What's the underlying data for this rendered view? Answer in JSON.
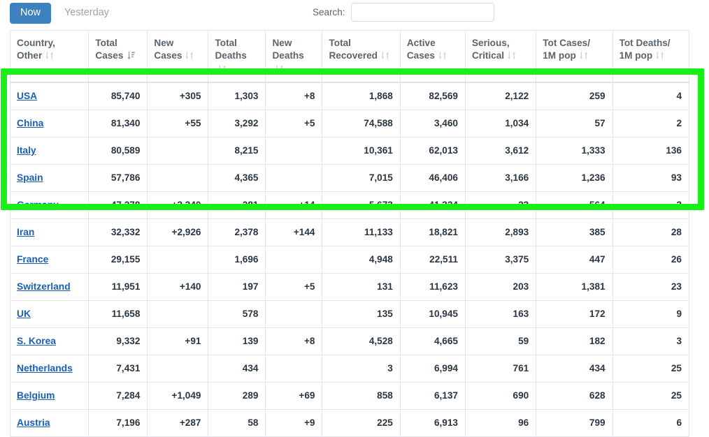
{
  "tabs": [
    {
      "label": "Now",
      "active": true,
      "name": "tab-now"
    },
    {
      "label": "Yesterday",
      "active": false,
      "name": "tab-yesterday"
    }
  ],
  "search": {
    "label": "Search:",
    "value": "",
    "placeholder": ""
  },
  "colors": {
    "accent_blue": "#3d82bf",
    "link_blue": "#1a5fb4",
    "new_cases_highlight": "#fcefc2",
    "new_deaths_highlight": "#ff0000",
    "annotation_green": "#18f018"
  },
  "table": {
    "columns": [
      {
        "label": "Country, Other",
        "key": "country",
        "sort": "none",
        "name": "col-header-country"
      },
      {
        "label": "Total Cases",
        "key": "total_cases",
        "sort": "desc",
        "name": "col-header-total-cases"
      },
      {
        "label": "New Cases",
        "key": "new_cases",
        "sort": "none",
        "name": "col-header-new-cases"
      },
      {
        "label": "Total Deaths",
        "key": "total_deaths",
        "sort": "none",
        "name": "col-header-total-deaths"
      },
      {
        "label": "New Deaths",
        "key": "new_deaths",
        "sort": "none",
        "name": "col-header-new-deaths"
      },
      {
        "label": "Total Recovered",
        "key": "recovered",
        "sort": "none",
        "name": "col-header-total-recovered"
      },
      {
        "label": "Active Cases",
        "key": "active",
        "sort": "none",
        "name": "col-header-active-cases"
      },
      {
        "label": "Serious, Critical",
        "key": "serious",
        "sort": "none",
        "name": "col-header-serious-critical"
      },
      {
        "label": "Tot Cases/ 1M pop",
        "key": "cases_per_m",
        "sort": "none",
        "name": "col-header-tot-cases-per-1m"
      },
      {
        "label": "Tot Deaths/ 1M pop",
        "key": "deaths_per_m",
        "sort": "none",
        "name": "col-header-tot-deaths-per-1m"
      }
    ],
    "rows": [
      {
        "country": "USA",
        "total_cases": "85,740",
        "new_cases": "+305",
        "total_deaths": "1,303",
        "new_deaths": "+8",
        "recovered": "1,868",
        "active": "82,569",
        "serious": "2,122",
        "cases_per_m": "259",
        "deaths_per_m": "4"
      },
      {
        "country": "China",
        "total_cases": "81,340",
        "new_cases": "+55",
        "total_deaths": "3,292",
        "new_deaths": "+5",
        "recovered": "74,588",
        "active": "3,460",
        "serious": "1,034",
        "cases_per_m": "57",
        "deaths_per_m": "2"
      },
      {
        "country": "Italy",
        "total_cases": "80,589",
        "new_cases": "",
        "total_deaths": "8,215",
        "new_deaths": "",
        "recovered": "10,361",
        "active": "62,013",
        "serious": "3,612",
        "cases_per_m": "1,333",
        "deaths_per_m": "136"
      },
      {
        "country": "Spain",
        "total_cases": "57,786",
        "new_cases": "",
        "total_deaths": "4,365",
        "new_deaths": "",
        "recovered": "7,015",
        "active": "46,406",
        "serious": "3,166",
        "cases_per_m": "1,236",
        "deaths_per_m": "93"
      },
      {
        "country": "Germany",
        "total_cases": "47,278",
        "new_cases": "+3,340",
        "total_deaths": "281",
        "new_deaths": "+14",
        "recovered": "5,673",
        "active": "41,324",
        "serious": "23",
        "cases_per_m": "564",
        "deaths_per_m": "3"
      },
      {
        "country": "Iran",
        "total_cases": "32,332",
        "new_cases": "+2,926",
        "total_deaths": "2,378",
        "new_deaths": "+144",
        "recovered": "11,133",
        "active": "18,821",
        "serious": "2,893",
        "cases_per_m": "385",
        "deaths_per_m": "28"
      },
      {
        "country": "France",
        "total_cases": "29,155",
        "new_cases": "",
        "total_deaths": "1,696",
        "new_deaths": "",
        "recovered": "4,948",
        "active": "22,511",
        "serious": "3,375",
        "cases_per_m": "447",
        "deaths_per_m": "26"
      },
      {
        "country": "Switzerland",
        "total_cases": "11,951",
        "new_cases": "+140",
        "total_deaths": "197",
        "new_deaths": "+5",
        "recovered": "131",
        "active": "11,623",
        "serious": "203",
        "cases_per_m": "1,381",
        "deaths_per_m": "23"
      },
      {
        "country": "UK",
        "total_cases": "11,658",
        "new_cases": "",
        "total_deaths": "578",
        "new_deaths": "",
        "recovered": "135",
        "active": "10,945",
        "serious": "163",
        "cases_per_m": "172",
        "deaths_per_m": "9"
      },
      {
        "country": "S. Korea",
        "total_cases": "9,332",
        "new_cases": "+91",
        "total_deaths": "139",
        "new_deaths": "+8",
        "recovered": "4,528",
        "active": "4,665",
        "serious": "59",
        "cases_per_m": "182",
        "deaths_per_m": "3"
      },
      {
        "country": "Netherlands",
        "total_cases": "7,431",
        "new_cases": "",
        "total_deaths": "434",
        "new_deaths": "",
        "recovered": "3",
        "active": "6,994",
        "serious": "761",
        "cases_per_m": "434",
        "deaths_per_m": "25"
      },
      {
        "country": "Belgium",
        "total_cases": "7,284",
        "new_cases": "+1,049",
        "total_deaths": "289",
        "new_deaths": "+69",
        "recovered": "858",
        "active": "6,137",
        "serious": "690",
        "cases_per_m": "628",
        "deaths_per_m": "25"
      },
      {
        "country": "Austria",
        "total_cases": "7,196",
        "new_cases": "+287",
        "total_deaths": "58",
        "new_deaths": "+9",
        "recovered": "225",
        "active": "6,913",
        "serious": "96",
        "cases_per_m": "799",
        "deaths_per_m": "6"
      }
    ]
  },
  "annotation": {
    "type": "highlight-box",
    "covers_rows": [
      "USA",
      "China",
      "Italy",
      "Spain",
      "Germany"
    ]
  }
}
